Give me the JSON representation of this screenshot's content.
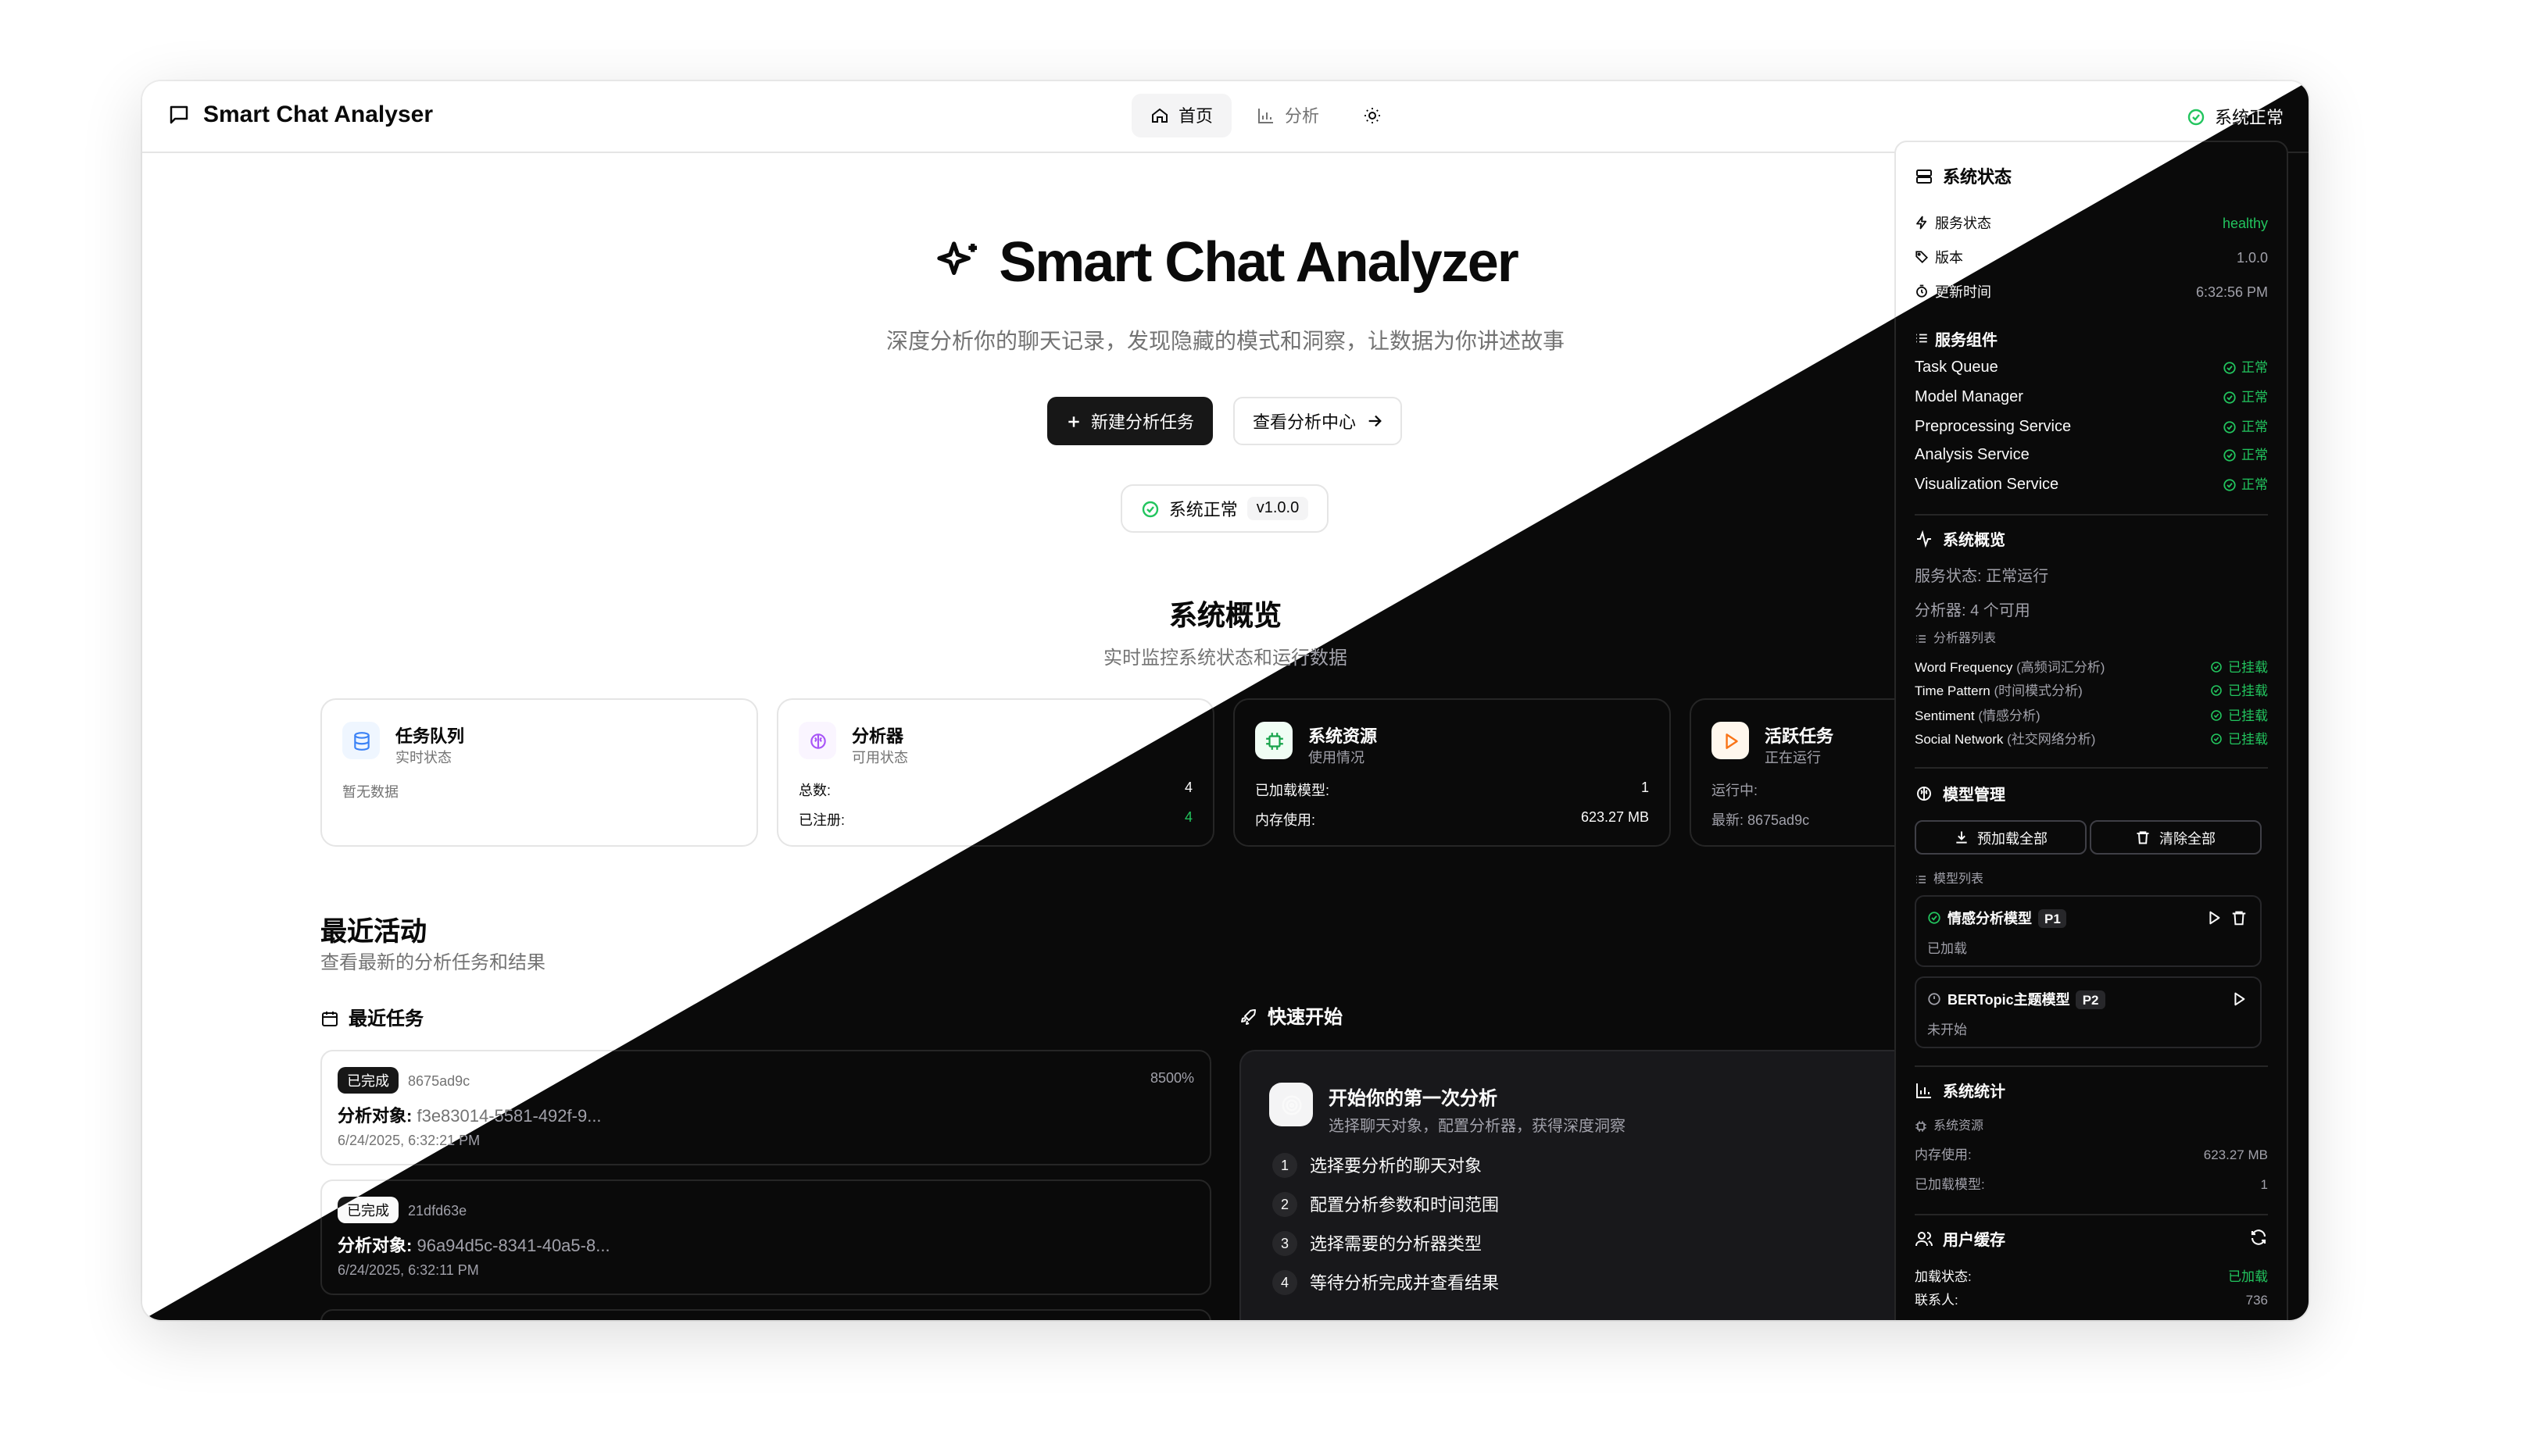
{
  "header": {
    "app_name": "Smart Chat Analyser",
    "nav": [
      {
        "label": "首页",
        "active": true
      },
      {
        "label": "分析",
        "active": false
      }
    ],
    "system_status": "系统正常"
  },
  "hero": {
    "title": "Smart Chat Analyzer",
    "subtitle": "深度分析你的聊天记录，发现隐藏的模式和洞察，让数据为你讲述故事",
    "primary_button": "新建分析任务",
    "secondary_button": "查看分析中心",
    "status_pill": "系统正常",
    "version": "v1.0.0"
  },
  "overview": {
    "title": "系统概览",
    "subtitle": "实时监控系统状态和运行数据",
    "cards": [
      {
        "title": "任务队列",
        "subtitle": "实时状态",
        "empty": "暂无数据"
      },
      {
        "title": "分析器",
        "subtitle": "可用状态",
        "rows": [
          {
            "label": "总数:",
            "value": "4"
          },
          {
            "label": "已注册:",
            "value": "4"
          }
        ]
      },
      {
        "title": "系统资源",
        "subtitle": "使用情况",
        "rows": [
          {
            "label": "已加载模型:",
            "value": "1"
          },
          {
            "label": "内存使用:",
            "value": "623.27 MB"
          }
        ]
      },
      {
        "title": "活跃任务",
        "subtitle": "正在运行",
        "rows": [
          {
            "label": "运行中:",
            "value": ""
          },
          {
            "label": "最新: 8675ad9c",
            "value": ""
          }
        ]
      }
    ]
  },
  "activity": {
    "title": "最近活动",
    "subtitle": "查看最新的分析任务和结果",
    "recent_tasks_label": "最近任务",
    "tasks": [
      {
        "status": "已完成",
        "id": "8675ad9c",
        "progress": "8500%",
        "target_label": "分析对象:",
        "target": "f3e83014-5581-492f-9...",
        "time": "6/24/2025, 6:32:21 PM"
      },
      {
        "status": "已完成",
        "id": "21dfd63e",
        "progress": "",
        "target_label": "分析对象:",
        "target": "96a94d5c-8341-40a5-8...",
        "time": "6/24/2025, 6:32:11 PM"
      }
    ],
    "quick_start": {
      "label": "快速开始",
      "title": "开始你的第一次分析",
      "subtitle": "选择聊天对象，配置分析器，获得深度洞察",
      "steps": [
        {
          "n": "1",
          "text": "选择要分析的聊天对象"
        },
        {
          "n": "2",
          "text": "配置分析参数和时间范围"
        },
        {
          "n": "3",
          "text": "选择需要的分析器类型"
        },
        {
          "n": "4",
          "text": "等待分析完成并查看结果"
        }
      ]
    }
  },
  "panel": {
    "system_status": {
      "title": "系统状态",
      "rows": [
        {
          "label": "服务状态",
          "value": "healthy"
        },
        {
          "label": "版本",
          "value": "1.0.0"
        },
        {
          "label": "更新时间",
          "value": "6:32:56 PM"
        }
      ]
    },
    "components": {
      "title": "服务组件",
      "items": [
        {
          "name": "Task Queue",
          "status": "正常"
        },
        {
          "name": "Model Manager",
          "status": "正常"
        },
        {
          "name": "Preprocessing Service",
          "status": "正常"
        },
        {
          "name": "Analysis Service",
          "status": "正常"
        },
        {
          "name": "Visualization Service",
          "status": "正常"
        }
      ]
    },
    "overview": {
      "title": "系统概览",
      "service_state": "服务状态: 正常运行",
      "analyzers": "分析器: 4 个可用",
      "analyzer_list_label": "分析器列表",
      "analyzers_list": [
        {
          "name": "Word Frequency",
          "desc": "(高频词汇分析)",
          "status": "已挂载"
        },
        {
          "name": "Time Pattern",
          "desc": "(时间模式分析)",
          "status": "已挂载"
        },
        {
          "name": "Sentiment",
          "desc": "(情感分析)",
          "status": "已挂载"
        },
        {
          "name": "Social Network",
          "desc": "(社交网络分析)",
          "status": "已挂载"
        }
      ]
    },
    "models": {
      "title": "模型管理",
      "preload_all": "预加载全部",
      "clear_all": "清除全部",
      "list_label": "模型列表",
      "items": [
        {
          "name": "情感分析模型",
          "priority": "P1",
          "status": "已加载"
        },
        {
          "name": "BERTopic主题模型",
          "priority": "P2",
          "status": "未开始"
        }
      ]
    },
    "stats": {
      "title": "系统统计",
      "resources_label": "系统资源",
      "rows": [
        {
          "label": "内存使用:",
          "value": "623.27 MB"
        },
        {
          "label": "已加载模型:",
          "value": "1"
        }
      ]
    },
    "user_cache": {
      "title": "用户缓存",
      "rows": [
        {
          "label": "加载状态:",
          "value": "已加载"
        },
        {
          "label": "联系人:",
          "value": "736"
        }
      ]
    }
  },
  "colors": {
    "accent": "#171717",
    "success": "#22c55e",
    "blue": "#3b82f6",
    "purple": "#a855f7",
    "green_icon": "#16a34a",
    "orange": "#f97316"
  }
}
